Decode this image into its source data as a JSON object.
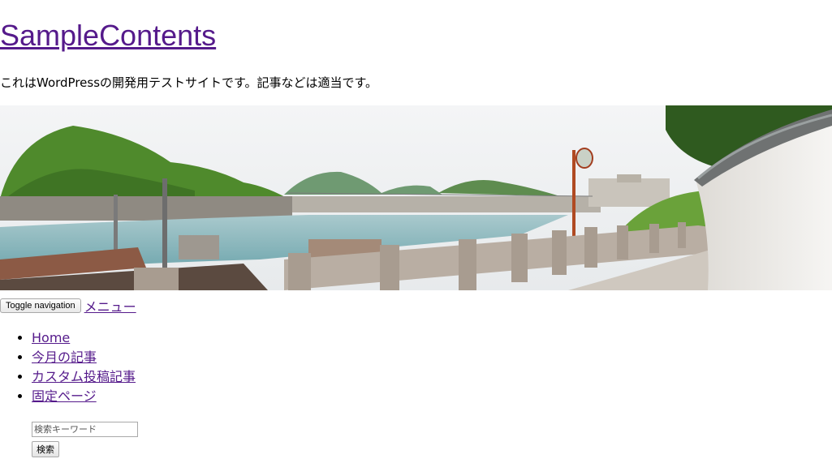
{
  "site": {
    "title": "SampleContents",
    "description": "これはWordPressの開発用テストサイトです。記事などは適当です。"
  },
  "header_image": {
    "description_icon": "harbor-town-panorama-image"
  },
  "nav": {
    "toggle_label": "Toggle navigation",
    "menu_label": "メニュー",
    "items": [
      {
        "label": "Home"
      },
      {
        "label": "今月の記事"
      },
      {
        "label": "カスタム投稿記事"
      },
      {
        "label": "固定ページ"
      }
    ]
  },
  "search": {
    "placeholder": "検索キーワード",
    "button_label": "検索"
  },
  "colors": {
    "link": "#551a8b",
    "sea": "#7fb3b9",
    "sky": "#eef0f2",
    "foliage": "#4f8a2c"
  }
}
